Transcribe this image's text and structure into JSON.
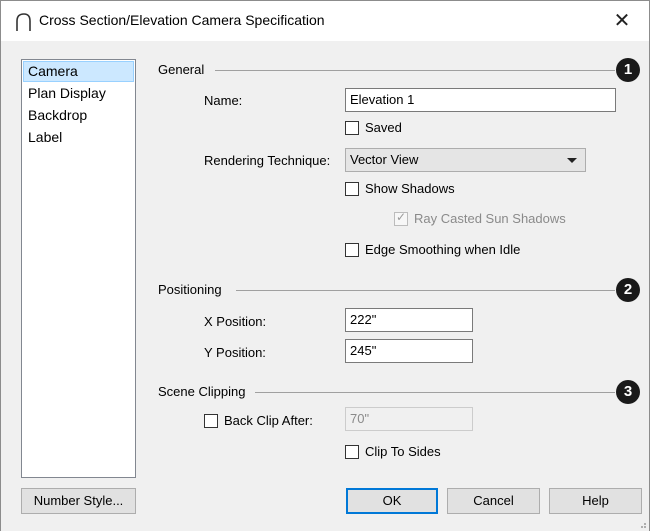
{
  "window": {
    "title": "Cross Section/Elevation Camera Specification",
    "close_glyph": "✕"
  },
  "sidebar": {
    "items": [
      {
        "label": "Camera",
        "selected": true
      },
      {
        "label": "Plan Display",
        "selected": false
      },
      {
        "label": "Backdrop",
        "selected": false
      },
      {
        "label": "Label",
        "selected": false
      }
    ]
  },
  "general": {
    "heading": "General",
    "badge": "1",
    "name_label": "Name:",
    "name_value": "Elevation 1",
    "saved_label": "Saved",
    "saved_checked": false,
    "rendering_label": "Rendering Technique:",
    "rendering_value": "Vector View",
    "show_shadows_label": "Show Shadows",
    "show_shadows_checked": false,
    "ray_casted_label": "Ray Casted Sun Shadows",
    "ray_casted_checked": true,
    "edge_smoothing_label": "Edge Smoothing when Idle",
    "edge_smoothing_checked": false
  },
  "positioning": {
    "heading": "Positioning",
    "badge": "2",
    "x_label": "X Position:",
    "x_value": "222\"",
    "y_label": "Y Position:",
    "y_value": "245\""
  },
  "scene_clipping": {
    "heading": "Scene Clipping",
    "badge": "3",
    "back_clip_label": "Back Clip After:",
    "back_clip_checked": false,
    "back_clip_value": "70\"",
    "clip_sides_label": "Clip To Sides",
    "clip_sides_checked": false
  },
  "footer": {
    "number_style_label": "Number Style...",
    "ok_label": "OK",
    "cancel_label": "Cancel",
    "help_label": "Help"
  },
  "colors": {
    "selected_item_bg": "#cce8ff",
    "default_button_border": "#0078d7",
    "badge_bg": "#1a1a1a"
  }
}
